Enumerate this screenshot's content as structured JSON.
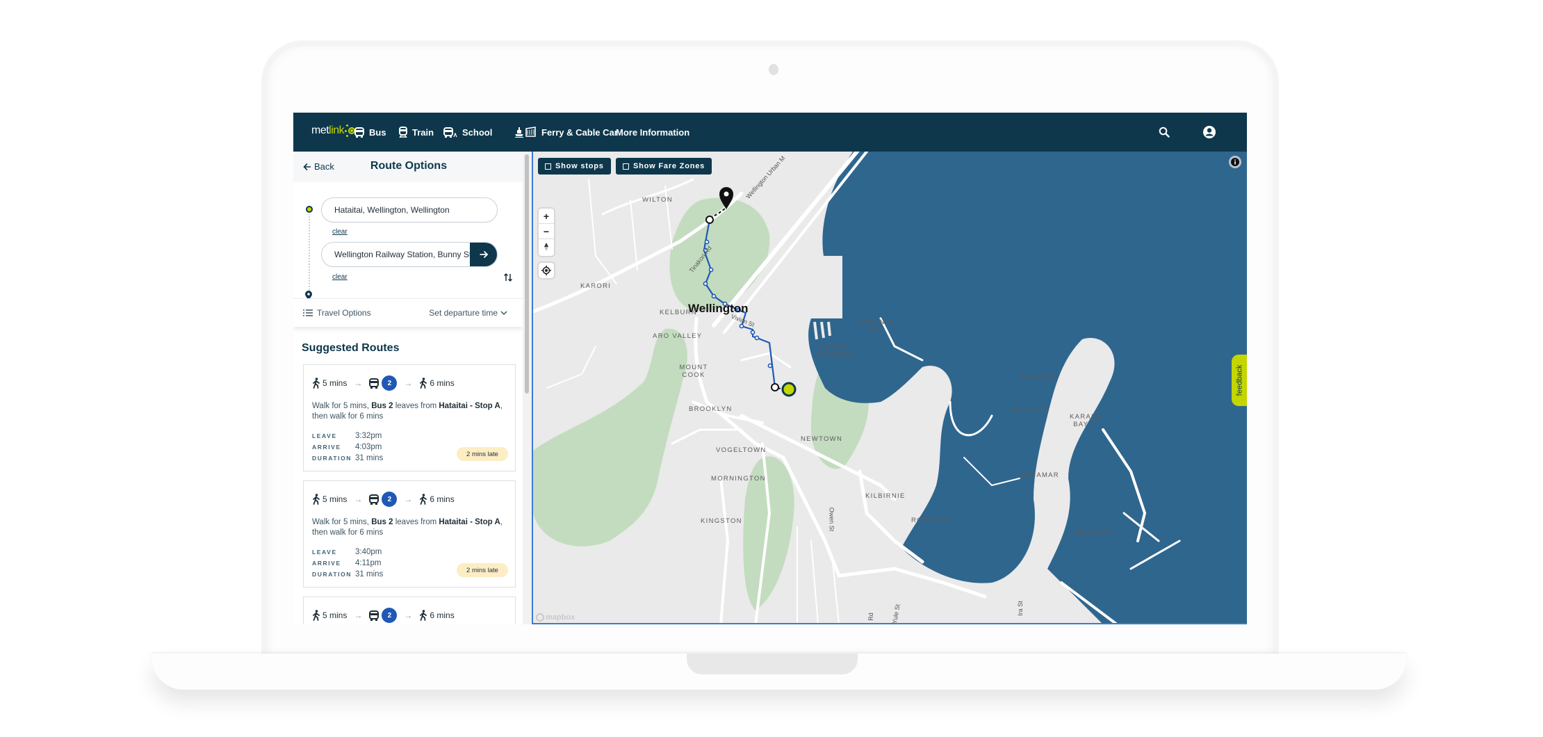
{
  "nav": {
    "logo_prefix": "met",
    "logo_suffix": "link",
    "items": [
      {
        "label": "Bus",
        "icon": "bus-icon"
      },
      {
        "label": "Train",
        "icon": "train-icon"
      },
      {
        "label": "School",
        "icon": "school-bus-icon"
      },
      {
        "label": "Ferry & Cable Car",
        "icon": "ferry-cable-car-icon"
      },
      {
        "label": "More Information"
      }
    ],
    "search_icon": "search-icon",
    "account_icon": "account-icon"
  },
  "panel": {
    "back_label": "Back",
    "title": "Route Options",
    "origin": {
      "value": "Hataitai, Wellington, Wellington",
      "clear_label": "clear"
    },
    "destination": {
      "value": "Wellington Railway Station, Bunny St,",
      "clear_label": "clear"
    },
    "travel_options_label": "Travel Options",
    "departure_label": "Set departure time",
    "suggested_title": "Suggested Routes",
    "routes": [
      {
        "walk1": "5 mins",
        "bus": "2",
        "walk2": "6 mins",
        "desc_a": "Walk for 5 mins, ",
        "desc_bus": "Bus 2",
        "desc_b": " leaves from ",
        "desc_stop": "Hataitai - Stop A",
        "desc_c": ", then walk for 6 mins",
        "leave_label": "LEAVE",
        "leave": "3:32pm",
        "arrive_label": "ARRIVE",
        "arrive": "4:03pm",
        "duration_label": "DURATION",
        "duration": "31 mins",
        "status": "2 mins late"
      },
      {
        "walk1": "5 mins",
        "bus": "2",
        "walk2": "6 mins",
        "desc_a": "Walk for 5 mins, ",
        "desc_bus": "Bus 2",
        "desc_b": " leaves from ",
        "desc_stop": "Hataitai - Stop A",
        "desc_c": ", then walk for 6 mins",
        "leave_label": "LEAVE",
        "leave": "3:40pm",
        "arrive_label": "ARRIVE",
        "arrive": "4:11pm",
        "duration_label": "DURATION",
        "duration": "31 mins",
        "status": "2 mins late"
      },
      {
        "walk1": "5 mins",
        "bus": "2",
        "walk2": "6 mins"
      }
    ]
  },
  "map": {
    "show_stops_label": "Show stops",
    "show_fare_zones_label": "Show Fare Zones",
    "feedback_label": "feedback",
    "attribution": "mapbox",
    "city_label": "Wellington",
    "suburbs": [
      "WILTON",
      "KARORI",
      "KELBURN",
      "ORIENTAL BAY",
      "ARO VALLEY",
      "MOUNT VICTORIA",
      "MOUNT COOK",
      "BROOKLYN",
      "NEWTOWN",
      "VOGELTOWN",
      "MORNINGTON",
      "KINGSTON",
      "KILBIRNIE",
      "RONGOTAI",
      "MIRAMAR",
      "MAUPUIA",
      "MAUPUIA",
      "KARAKA BAYS",
      "SEATOUN"
    ],
    "streets": [
      "Tinakori Rd",
      "Wellington Urban M",
      "Vivian St",
      "Owen St",
      "Ira St",
      "Yule St",
      "Rd"
    ],
    "colors": {
      "water": "#2f668e",
      "land": "#eaeaea",
      "park": "#c3dcbf",
      "route": "#1f58b5",
      "origin": "#c4d600",
      "nav": "#0e374c"
    }
  }
}
